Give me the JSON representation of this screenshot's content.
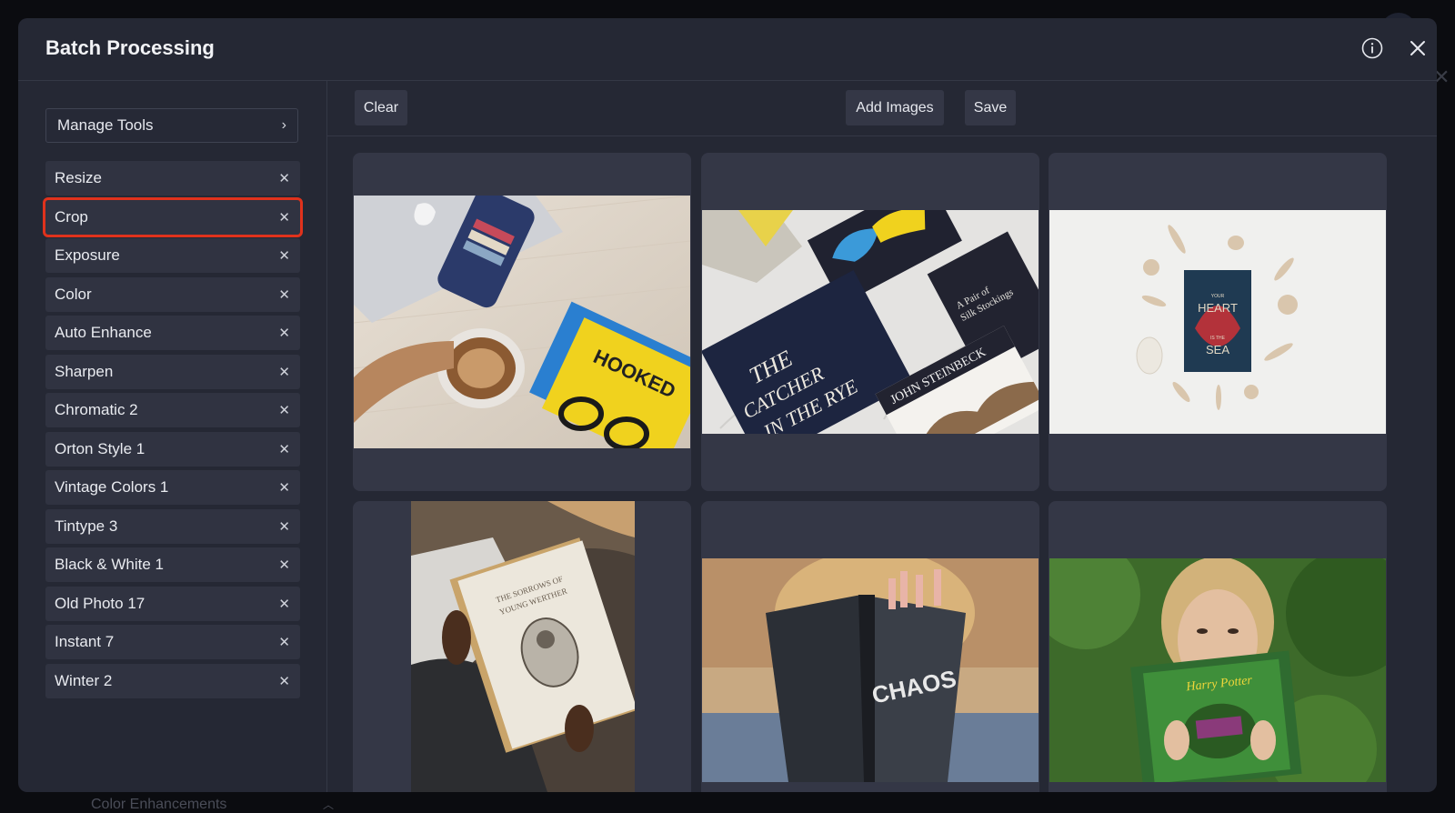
{
  "modal": {
    "title": "Batch Processing"
  },
  "sidebar": {
    "manage_tools_label": "Manage Tools",
    "tools": [
      {
        "label": "Resize"
      },
      {
        "label": "Crop",
        "selected": true
      },
      {
        "label": "Exposure"
      },
      {
        "label": "Color"
      },
      {
        "label": "Auto Enhance"
      },
      {
        "label": "Sharpen"
      },
      {
        "label": "Chromatic 2"
      },
      {
        "label": "Orton Style 1"
      },
      {
        "label": "Vintage Colors 1"
      },
      {
        "label": "Tintype 3"
      },
      {
        "label": "Black & White 1"
      },
      {
        "label": "Old Photo 17"
      },
      {
        "label": "Instant 7"
      },
      {
        "label": "Winter 2"
      }
    ]
  },
  "toolbar": {
    "clear_label": "Clear",
    "add_images_label": "Add Images",
    "save_label": "Save"
  },
  "images": [
    {
      "icon": "photo-coffee-laptop-books",
      "text": "HOOKED"
    },
    {
      "icon": "photo-books-catcher-in-the-rye",
      "text": "THE CATCHER IN THE RYE"
    },
    {
      "icon": "photo-book-shells",
      "text": "YOUR HEART IS THE SEA"
    },
    {
      "icon": "photo-reading-young-werther",
      "text": "THE SORROWS OF YOUNG WERTHER"
    },
    {
      "icon": "photo-reading-chaos",
      "text": "CHAOS"
    },
    {
      "icon": "photo-reading-harry-potter",
      "text": "Harry Potter"
    }
  ],
  "background": {
    "section_label": "Color Enhancements"
  },
  "colors": {
    "modal_bg": "#252834",
    "item_bg": "#303341",
    "button_bg": "#343746",
    "selection_outline": "#e0321c"
  }
}
